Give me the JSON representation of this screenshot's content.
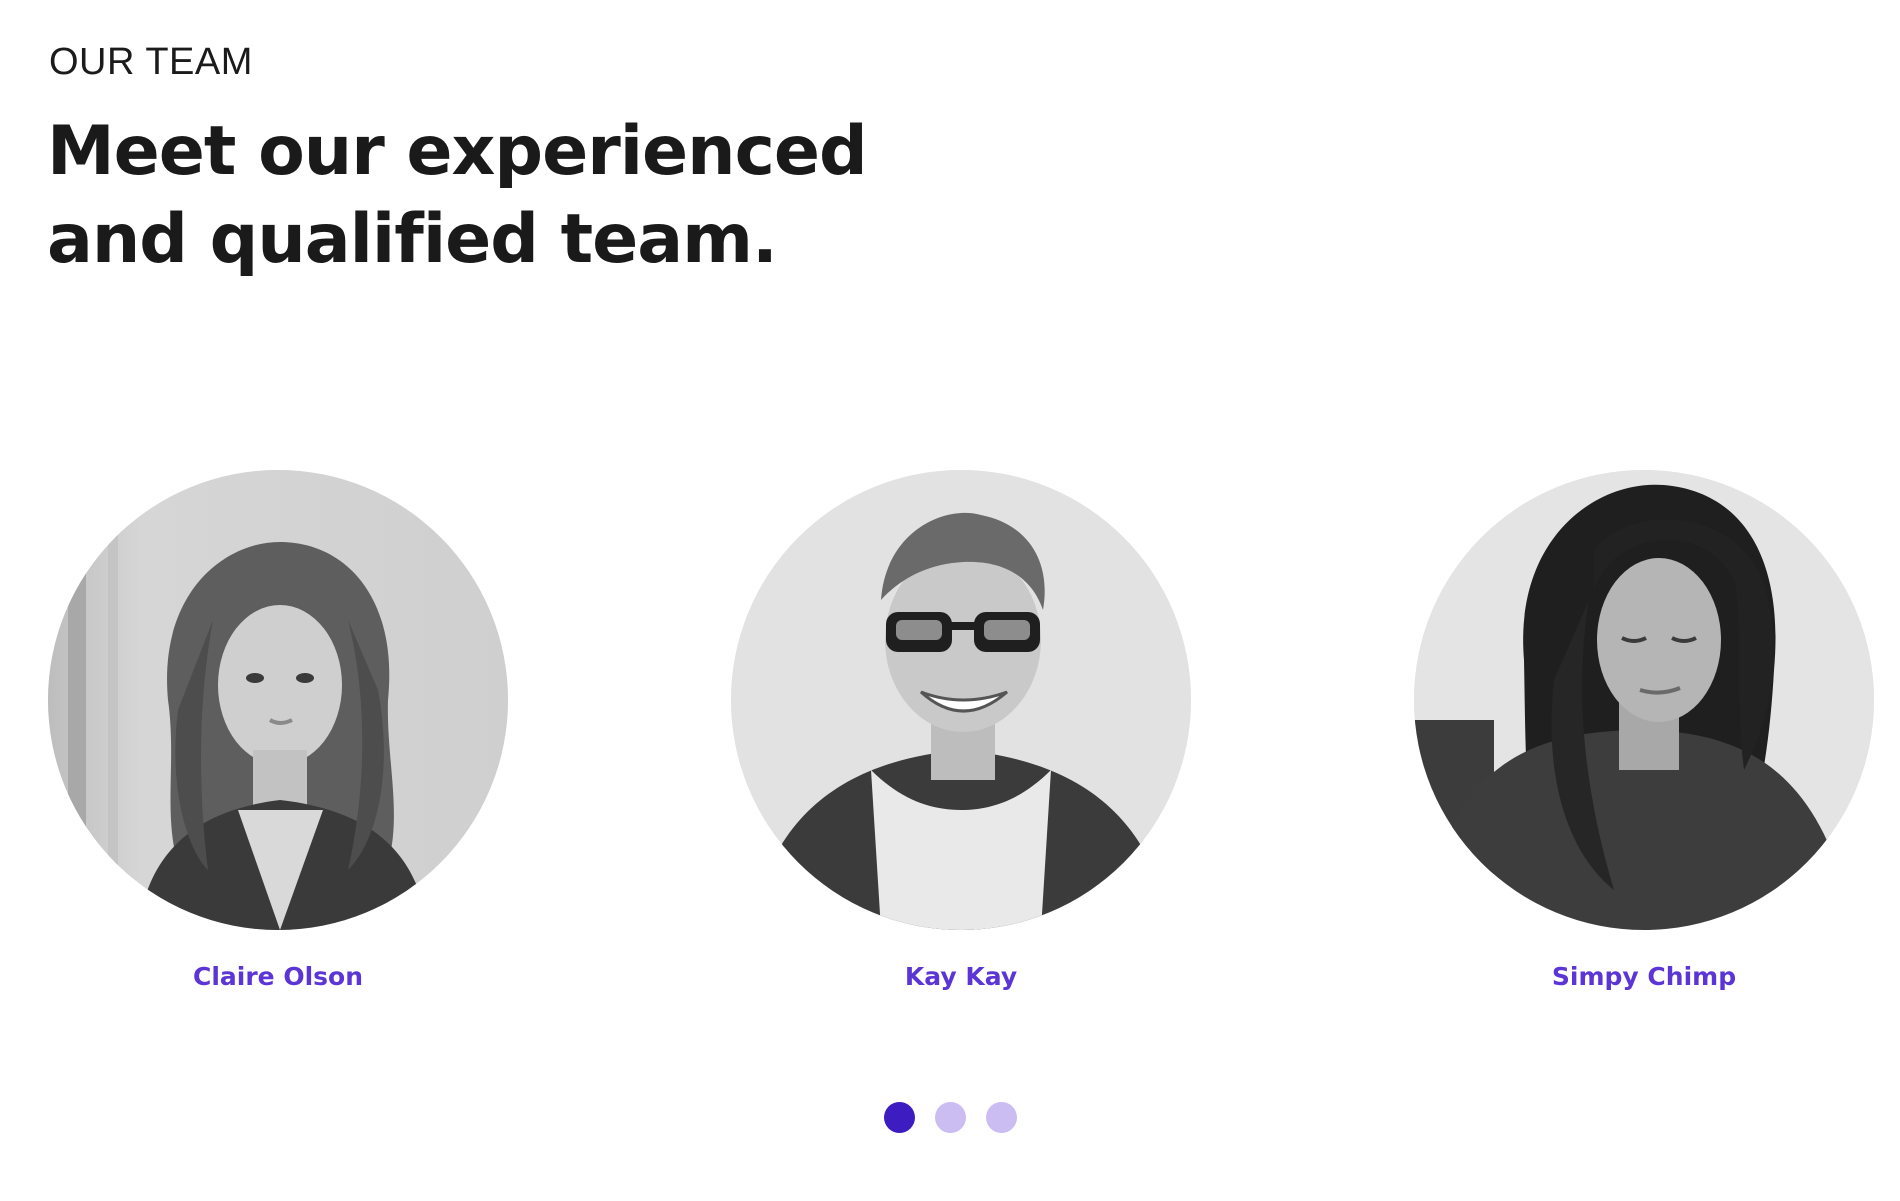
{
  "section": {
    "eyebrow": "OUR TEAM",
    "headline_line1": "Meet our experienced",
    "headline_line2": "and qualified team."
  },
  "team": [
    {
      "name": "Claire Olson",
      "photo": "portrait-woman-long-wavy-hair"
    },
    {
      "name": "Kay Kay",
      "photo": "portrait-smiling-man-sunglasses"
    },
    {
      "name": "Simpy Chimp",
      "photo": "portrait-woman-dark-hair-looking-down"
    }
  ],
  "carousel": {
    "active_index": 0,
    "page_count": 3,
    "active_color": "#3d1cc2",
    "inactive_color": "#cbbdf2"
  },
  "colors": {
    "name_accent": "#5b35d5",
    "heading": "#1a1a1a"
  }
}
